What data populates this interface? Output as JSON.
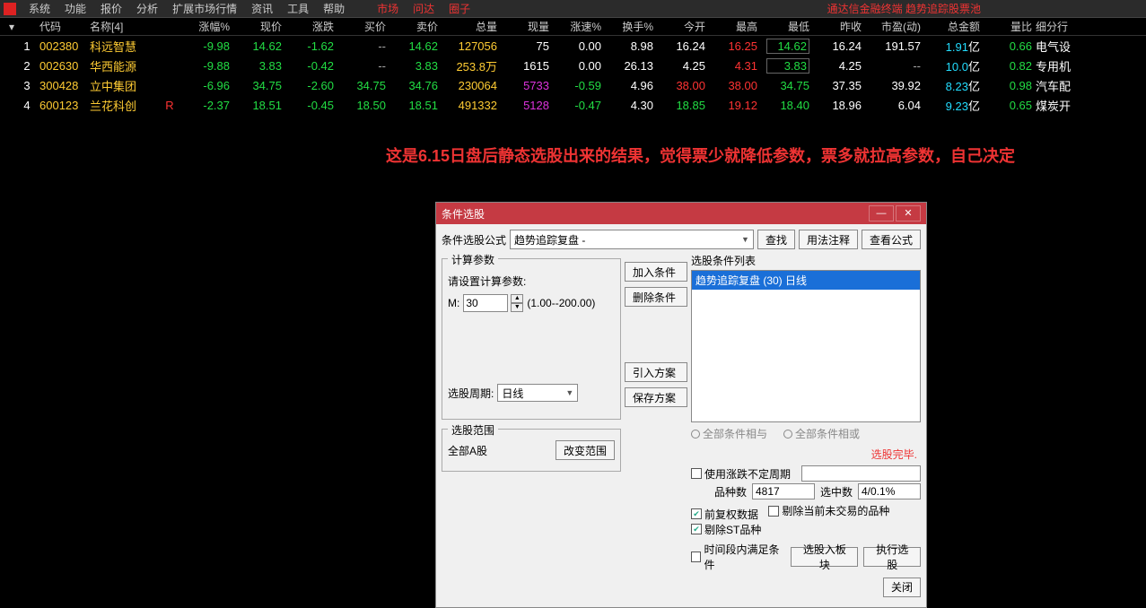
{
  "menu": {
    "items": [
      "系统",
      "功能",
      "报价",
      "分析",
      "扩展市场行情",
      "资讯",
      "工具",
      "帮助"
    ],
    "red_items": [
      "市场",
      "问达",
      "圈子"
    ]
  },
  "brand": "通达信金融终端  趋势追踪股票池",
  "headers": [
    "代码",
    "名称[4]",
    "",
    "涨幅%",
    "现价",
    "涨跌",
    "买价",
    "卖价",
    "总量",
    "现量",
    "涨速%",
    "换手%",
    "今开",
    "最高",
    "最低",
    "昨收",
    "市盈(动)",
    "总金额",
    "量比",
    "细分行"
  ],
  "rows": [
    {
      "idx": "1",
      "code": "002380",
      "name": "科远智慧",
      "r": "",
      "pct": "-9.98",
      "price": "14.62",
      "chg": "-1.62",
      "bid": "--",
      "ask": "14.62",
      "vol": "127056",
      "cur": "75",
      "spd": "0.00",
      "turn": "8.98",
      "open": "16.24",
      "high": "16.25",
      "low": "14.62",
      "pclose": "16.24",
      "pe": "191.57",
      "amt": "1.91",
      "amt_u": "亿",
      "vr": "0.66",
      "ind": "电气设",
      "low_box": true,
      "open_c": "white",
      "high_c": "red",
      "low_c": "green",
      "pe_c": "white"
    },
    {
      "idx": "2",
      "code": "002630",
      "name": "华西能源",
      "r": "",
      "pct": "-9.88",
      "price": "3.83",
      "chg": "-0.42",
      "bid": "--",
      "ask": "3.83",
      "vol": "253.8万",
      "cur": "1615",
      "spd": "0.00",
      "turn": "26.13",
      "open": "4.25",
      "high": "4.31",
      "low": "3.83",
      "pclose": "4.25",
      "pe": "--",
      "amt": "10.0",
      "amt_u": "亿",
      "vr": "0.82",
      "ind": "专用机",
      "low_box": true,
      "open_c": "white",
      "high_c": "red",
      "low_c": "green",
      "pe_c": "gray"
    },
    {
      "idx": "3",
      "code": "300428",
      "name": "立中集团",
      "r": "",
      "pct": "-6.96",
      "price": "34.75",
      "chg": "-2.60",
      "bid": "34.75",
      "ask": "34.76",
      "vol": "230064",
      "cur": "5733",
      "spd": "-0.59",
      "turn": "4.96",
      "open": "38.00",
      "high": "38.00",
      "low": "34.75",
      "pclose": "37.35",
      "pe": "39.92",
      "amt": "8.23",
      "amt_u": "亿",
      "vr": "0.98",
      "ind": "汽车配",
      "low_box": false,
      "open_c": "red",
      "high_c": "red",
      "low_c": "green",
      "pe_c": "white"
    },
    {
      "idx": "4",
      "code": "600123",
      "name": "兰花科创",
      "r": "R",
      "pct": "-2.37",
      "price": "18.51",
      "chg": "-0.45",
      "bid": "18.50",
      "ask": "18.51",
      "vol": "491332",
      "cur": "5128",
      "spd": "-0.47",
      "turn": "4.30",
      "open": "18.85",
      "high": "19.12",
      "low": "18.40",
      "pclose": "18.96",
      "pe": "6.04",
      "amt": "9.23",
      "amt_u": "亿",
      "vr": "0.65",
      "ind": "煤炭开",
      "low_box": false,
      "open_c": "green",
      "high_c": "red",
      "low_c": "green",
      "pe_c": "white"
    }
  ],
  "annotation": "这是6.15日盘后静态选股出来的结果，觉得票少就降低参数，票多就拉高参数，自己决定",
  "dialog": {
    "title": "条件选股",
    "formula_label": "条件选股公式",
    "formula_value": "趋势追踪复盘 -",
    "btn_find": "查找",
    "btn_usage": "用法注释",
    "btn_view": "查看公式",
    "calc_title": "计算参数",
    "calc_prompt": "请设置计算参数:",
    "param_m": "M:",
    "param_val": "30",
    "param_range": "(1.00--200.00)",
    "period_label": "选股周期:",
    "period_value": "日线",
    "btn_add": "加入条件",
    "btn_del": "删除条件",
    "btn_import": "引入方案",
    "btn_save": "保存方案",
    "list_title": "选股条件列表",
    "list_item": "趋势追踪复盘 (30) 日线",
    "radio_and": "全部条件相与",
    "radio_or": "全部条件相或",
    "done": "选股完毕.",
    "scope_title": "选股范围",
    "scope_value": "全部A股",
    "btn_scope": "改变范围",
    "chk_period": "使用涨跌不定周期",
    "stat_count_l": "品种数",
    "stat_count_v": "4817",
    "stat_sel_l": "选中数",
    "stat_sel_v": "4/0.1%",
    "chk_fq": "前复权数据",
    "chk_rm": "剔除当前未交易的品种",
    "chk_st": "剔除ST品种",
    "chk_time": "时间段内满足条件",
    "btn_toblock": "选股入板块",
    "btn_run": "执行选股",
    "btn_close": "关闭"
  }
}
